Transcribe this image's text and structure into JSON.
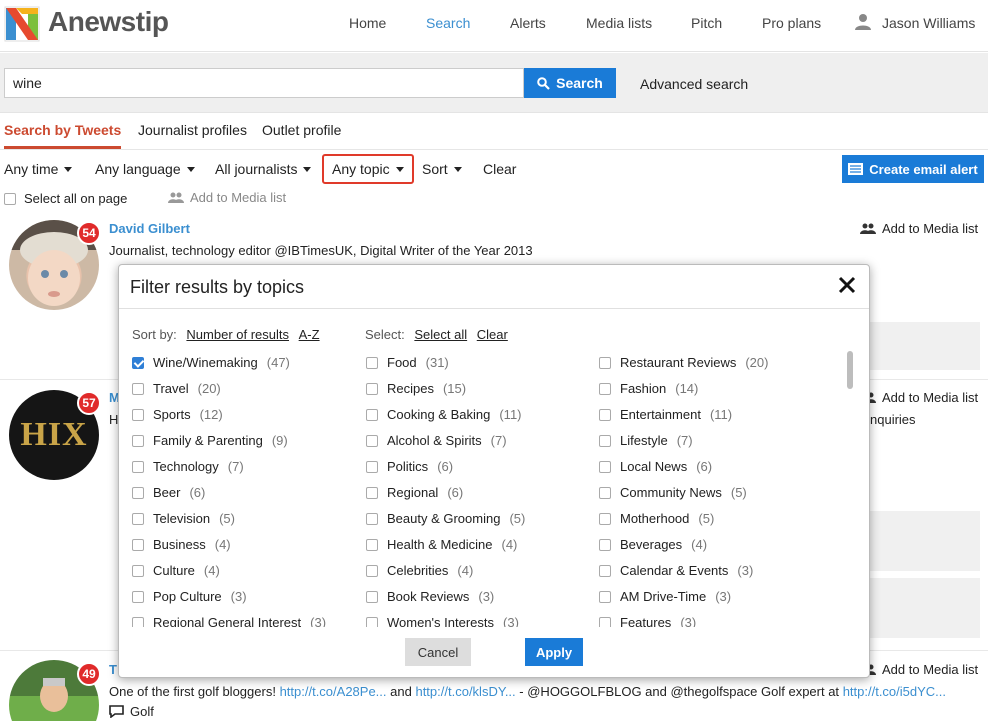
{
  "brand": {
    "name": "Anewstip"
  },
  "nav": {
    "home": "Home",
    "search": "Search",
    "alerts": "Alerts",
    "media_lists": "Media lists",
    "pitch": "Pitch",
    "pro_plans": "Pro plans",
    "user": "Jason Williams",
    "active": "Search"
  },
  "search": {
    "value": "wine",
    "button": "Search",
    "advanced": "Advanced search"
  },
  "tabs": {
    "tweets": "Search by Tweets",
    "journalists": "Journalist profiles",
    "outlets": "Outlet profile"
  },
  "filters": {
    "time": "Any time",
    "language": "Any language",
    "journalists": "All journalists",
    "topic": "Any topic",
    "sort": "Sort",
    "clear": "Clear",
    "email_alert": "Create email alert",
    "select_all": "Select all on page",
    "add_media": "Add to Media list"
  },
  "results": [
    {
      "name": "David Gilbert",
      "score": "54",
      "bio": "Journalist, technology editor @IBTimesUK, Digital Writer of the Year 2013",
      "add": "Add to Media list"
    },
    {
      "name": "M",
      "score": "57",
      "bio_start": "H",
      "bio_end": "nquiries",
      "avatar_text": "HIX",
      "add": "Add to Media list"
    },
    {
      "name": "T",
      "score": "49",
      "bio_prefix": "One of the first golf bloggers!",
      "link1": "http://t.co/A28Pe...",
      "and": "and",
      "link2": "http://t.co/klsDY...",
      "bio_mid": "- @HOGGOLFBLOG and @thegolfspace Golf expert at",
      "link3": "http://t.co/i5dYC...",
      "topic": "Golf",
      "add": "Add to Media list"
    }
  ],
  "modal": {
    "title": "Filter results by topics",
    "sort_label": "Sort by:",
    "sort_count": "Number of results",
    "sort_az": "A-Z",
    "select_label": "Select:",
    "select_all": "Select all",
    "select_clear": "Clear",
    "cancel": "Cancel",
    "apply": "Apply",
    "topics": [
      [
        {
          "label": "Wine/Winemaking",
          "count": "(47)",
          "checked": true
        },
        {
          "label": "Travel",
          "count": "(20)"
        },
        {
          "label": "Sports",
          "count": "(12)"
        },
        {
          "label": "Family & Parenting",
          "count": "(9)"
        },
        {
          "label": "Technology",
          "count": "(7)"
        },
        {
          "label": "Beer",
          "count": "(6)"
        },
        {
          "label": "Television",
          "count": "(5)"
        },
        {
          "label": "Business",
          "count": "(4)"
        },
        {
          "label": "Culture",
          "count": "(4)"
        },
        {
          "label": "Pop Culture",
          "count": "(3)"
        },
        {
          "label": "Regional General Interest",
          "count": "(3)"
        }
      ],
      [
        {
          "label": "Food",
          "count": "(31)"
        },
        {
          "label": "Recipes",
          "count": "(15)"
        },
        {
          "label": "Cooking & Baking",
          "count": "(11)"
        },
        {
          "label": "Alcohol & Spirits",
          "count": "(7)"
        },
        {
          "label": "Politics",
          "count": "(6)"
        },
        {
          "label": "Regional",
          "count": "(6)"
        },
        {
          "label": "Beauty & Grooming",
          "count": "(5)"
        },
        {
          "label": "Health & Medicine",
          "count": "(4)"
        },
        {
          "label": "Celebrities",
          "count": "(4)"
        },
        {
          "label": "Book Reviews",
          "count": "(3)"
        },
        {
          "label": "Women's Interests",
          "count": "(3)"
        }
      ],
      [
        {
          "label": "Restaurant Reviews",
          "count": "(20)"
        },
        {
          "label": "Fashion",
          "count": "(14)"
        },
        {
          "label": "Entertainment",
          "count": "(11)"
        },
        {
          "label": "Lifestyle",
          "count": "(7)"
        },
        {
          "label": "Local News",
          "count": "(6)"
        },
        {
          "label": "Community News",
          "count": "(5)"
        },
        {
          "label": "Motherhood",
          "count": "(5)"
        },
        {
          "label": "Beverages",
          "count": "(4)"
        },
        {
          "label": "Calendar & Events",
          "count": "(3)"
        },
        {
          "label": "AM Drive-Time",
          "count": "(3)"
        },
        {
          "label": "Features",
          "count": "(3)"
        }
      ]
    ]
  },
  "colors": {
    "accent": "#1a7bd7",
    "nav_active": "#3b8fd0",
    "tab_active": "#cc4a30",
    "badge": "#e02a2a",
    "highlight": "#e03a2a"
  }
}
